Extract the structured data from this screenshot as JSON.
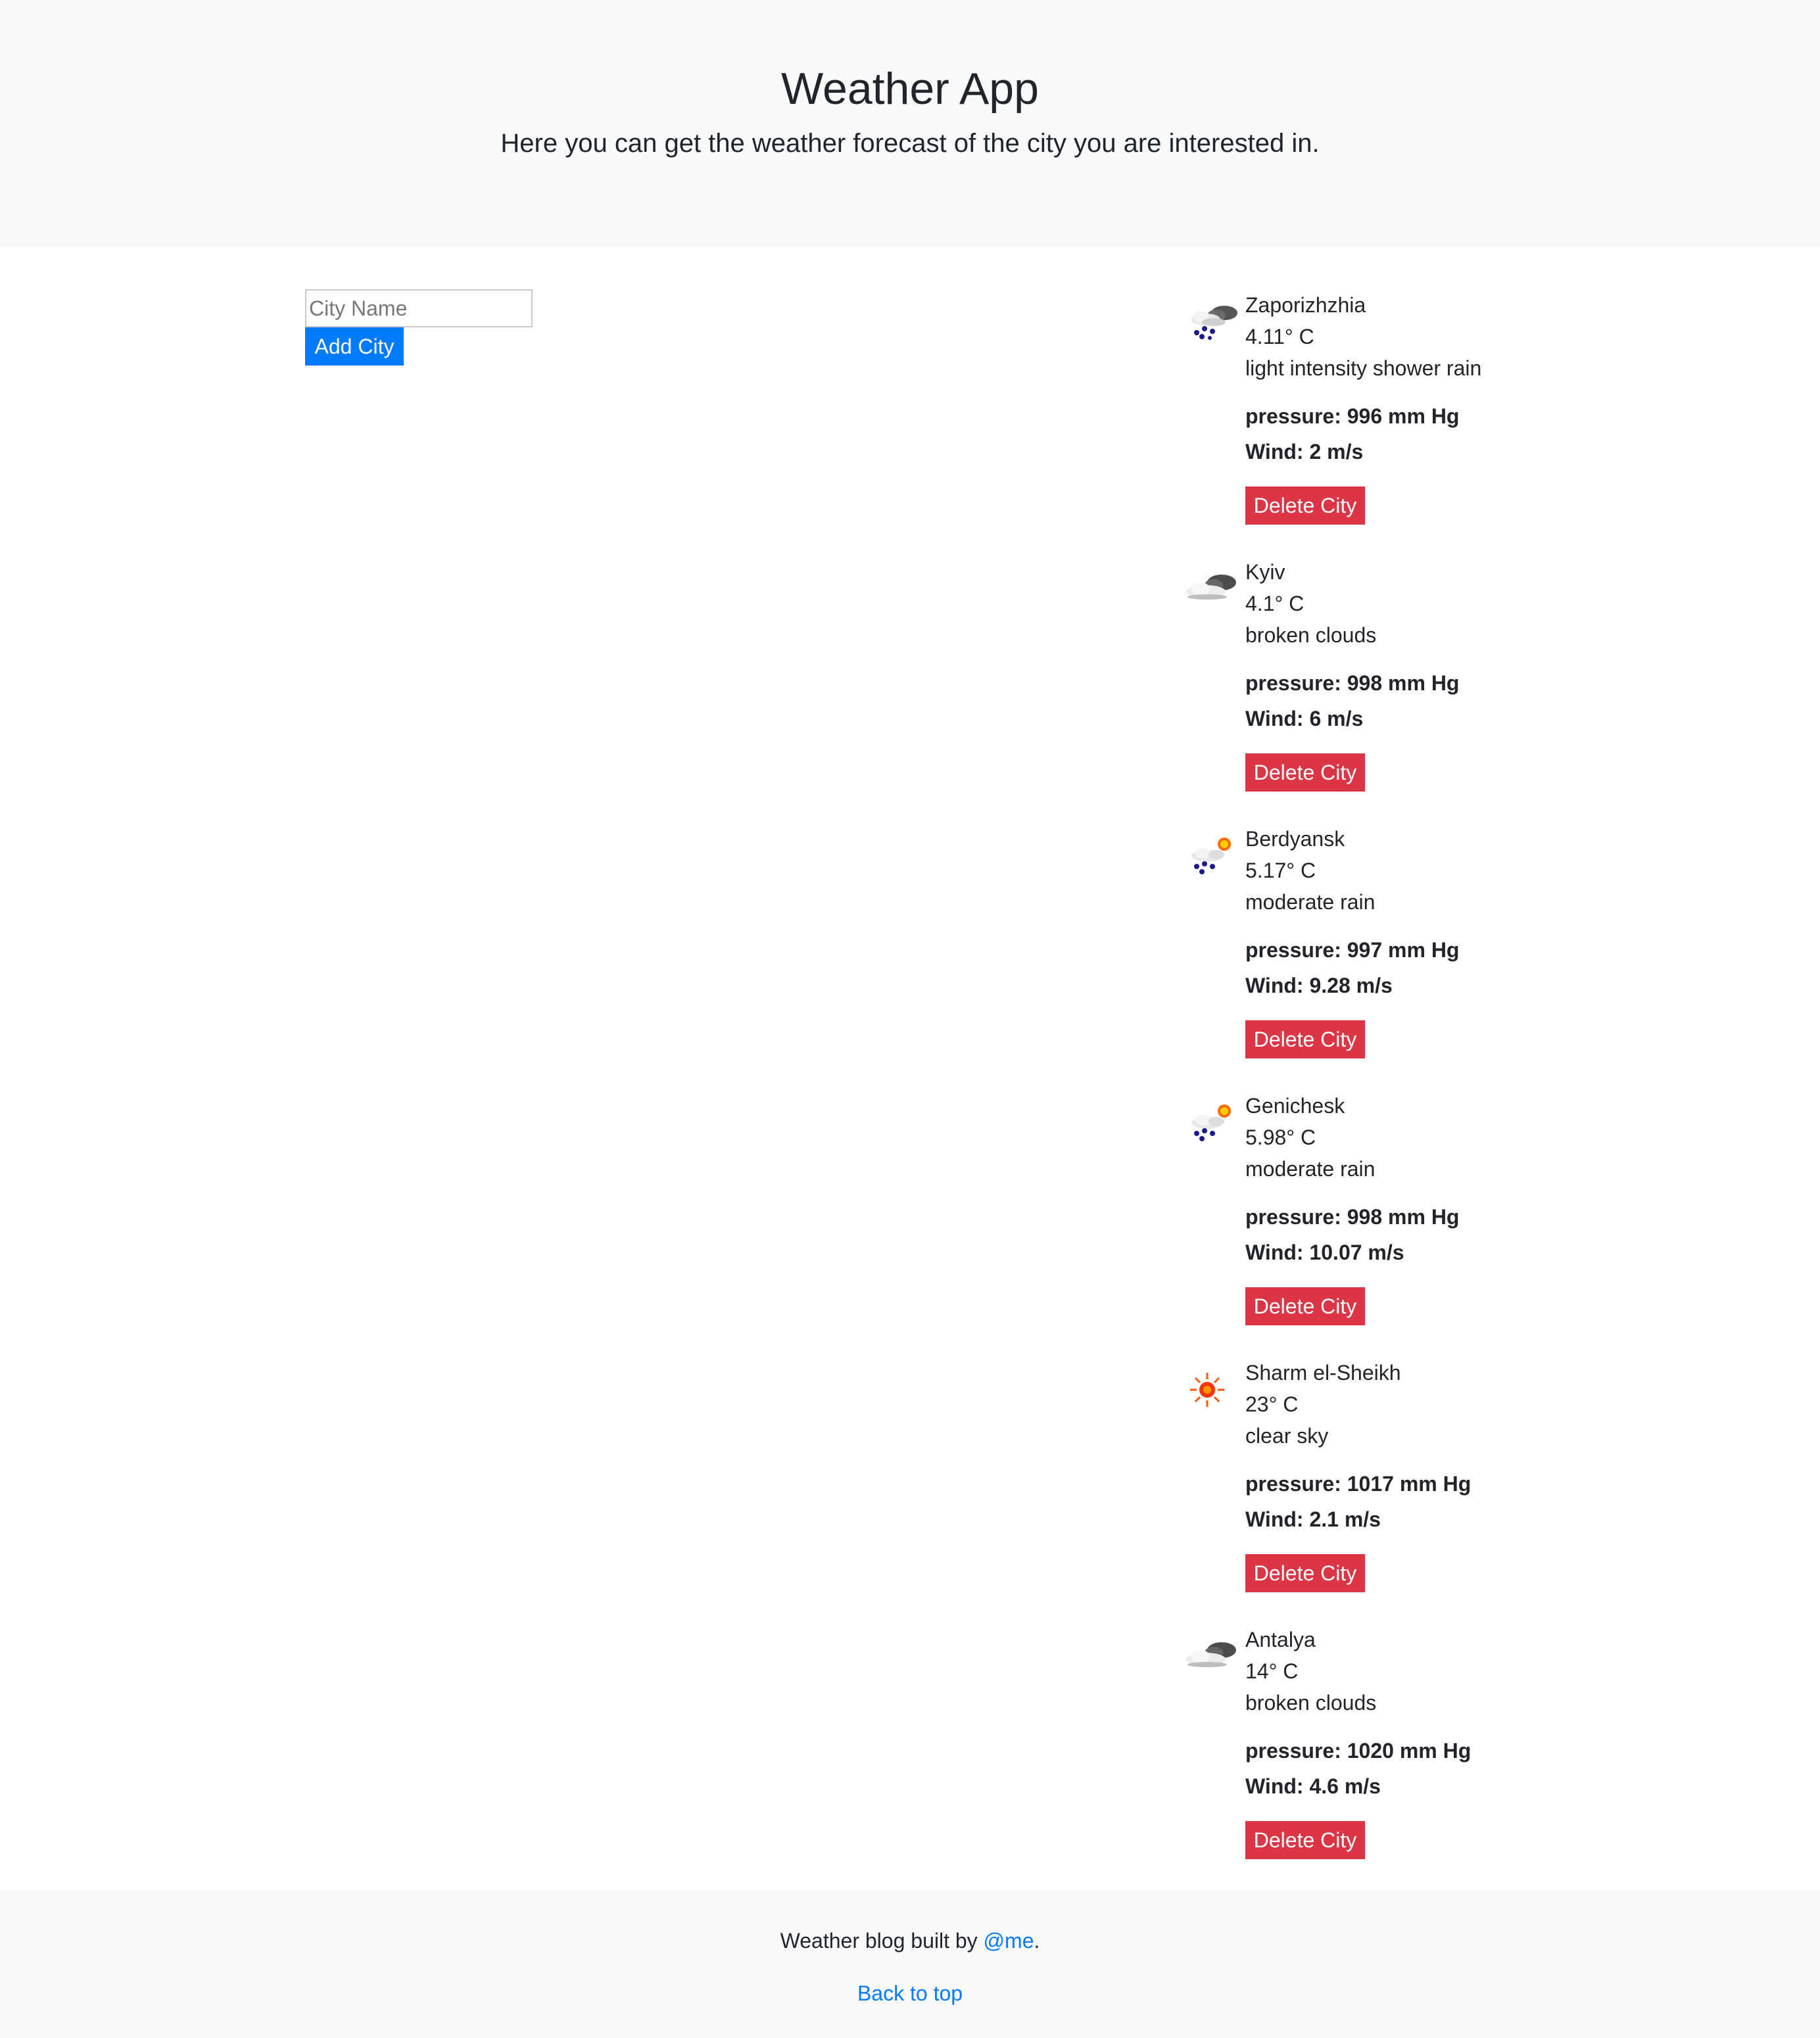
{
  "header": {
    "title": "Weather App",
    "subtitle": "Here you can get the weather forecast of the city you are interested in."
  },
  "form": {
    "placeholder": "City Name",
    "add_label": "Add City"
  },
  "cities": [
    {
      "name": "Zaporizhzhia",
      "temp": "4.11° C",
      "desc": "light intensity shower rain",
      "pressure": "pressure: 996 mm Hg",
      "wind": "Wind: 2 m/s",
      "delete_label": "Delete City",
      "icon": "shower-rain-icon"
    },
    {
      "name": "Kyiv",
      "temp": "4.1° C",
      "desc": "broken clouds",
      "pressure": "pressure: 998 mm Hg",
      "wind": "Wind: 6 m/s",
      "delete_label": "Delete City",
      "icon": "broken-clouds-icon"
    },
    {
      "name": "Berdyansk",
      "temp": "5.17° C",
      "desc": "moderate rain",
      "pressure": "pressure: 997 mm Hg",
      "wind": "Wind: 9.28 m/s",
      "delete_label": "Delete City",
      "icon": "sun-rain-icon"
    },
    {
      "name": "Genichesk",
      "temp": "5.98° C",
      "desc": "moderate rain",
      "pressure": "pressure: 998 mm Hg",
      "wind": "Wind: 10.07 m/s",
      "delete_label": "Delete City",
      "icon": "sun-rain-icon"
    },
    {
      "name": "Sharm el-Sheikh",
      "temp": "23° C",
      "desc": "clear sky",
      "pressure": "pressure: 1017 mm Hg",
      "wind": "Wind: 2.1 m/s",
      "delete_label": "Delete City",
      "icon": "sun-icon"
    },
    {
      "name": "Antalya",
      "temp": "14° C",
      "desc": "broken clouds",
      "pressure": "pressure: 1020 mm Hg",
      "wind": "Wind: 4.6 m/s",
      "delete_label": "Delete City",
      "icon": "broken-clouds-icon"
    }
  ],
  "footer": {
    "text_before": "Weather blog built by ",
    "link": "@me",
    "text_after": ".",
    "back_to_top": "Back to top"
  },
  "colors": {
    "primary": "#007bff",
    "danger": "#dc3545",
    "light_bg": "#f8f9fa"
  }
}
